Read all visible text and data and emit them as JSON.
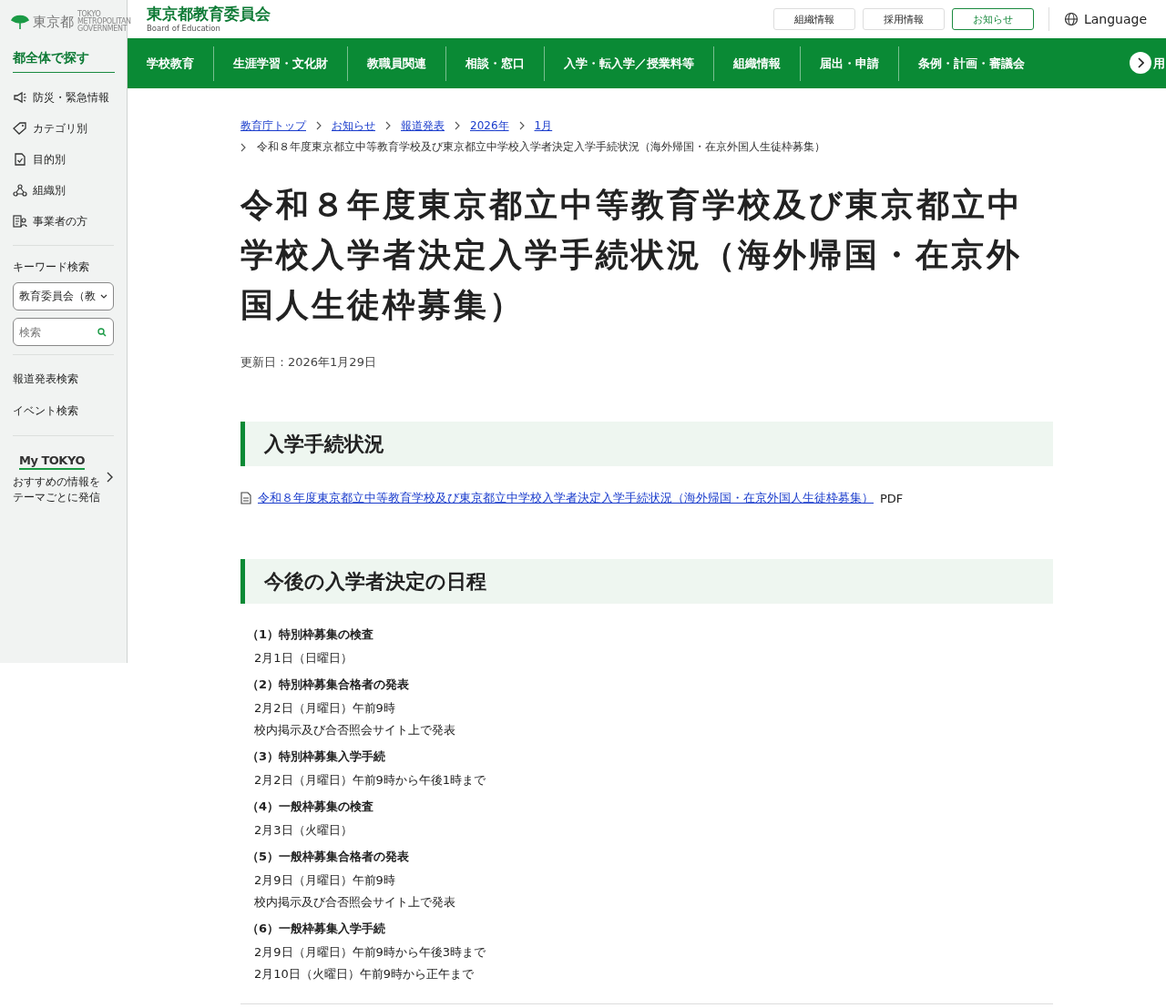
{
  "sidebar": {
    "logo": "東京都",
    "logo_sub": [
      "TOKYO",
      "METROPOLITAN",
      "GOVERNMENT"
    ],
    "heading": "都全体で探す",
    "items": [
      {
        "label": "防災・緊急情報"
      },
      {
        "label": "カテゴリ別"
      },
      {
        "label": "目的別"
      },
      {
        "label": "組織別"
      },
      {
        "label": "事業者の方"
      }
    ],
    "keyword_label": "キーワード検索",
    "scope_select": "教育委員会（教",
    "search": {
      "placeholder": "検索"
    },
    "links": [
      "報道発表検索",
      "イベント検索"
    ],
    "mytokyo": {
      "logo": "My TOKYO",
      "text": [
        "おすすめの情報を",
        "テーマごとに発信"
      ]
    }
  },
  "header": {
    "title": "東京都教育委員会",
    "subtitle": "Board of Education",
    "buttons": [
      {
        "label": "組織情報",
        "selected": false
      },
      {
        "label": "採用情報",
        "selected": false
      },
      {
        "label": "お知らせ",
        "selected": true
      }
    ],
    "language": "Language"
  },
  "nav": {
    "items": [
      "学校教育",
      "生涯学習・文化財",
      "教職員関連",
      "相談・窓口",
      "入学・転入学／授業料等",
      "組織情報",
      "届出・申請",
      "条例・計画・審議会"
    ],
    "cut_item": "用"
  },
  "breadcrumb": {
    "links": [
      "教育庁トップ",
      "お知らせ",
      "報道発表",
      "2026年",
      "1月"
    ],
    "current": "令和８年度東京都立中等教育学校及び東京都立中学校入学者決定入学手続状況（海外帰国・在京外国人生徒枠募集）"
  },
  "page_title": "令和８年度東京都立中等教育学校及び東京都立中学校入学者決定入学手続状況（海外帰国・在京外国人生徒枠募集）",
  "updated": "更新日：2026年1月29日",
  "sections": [
    {
      "heading": "入学手続状況",
      "file_link": {
        "label": "令和８年度東京都立中等教育学校及び東京都立中学校入学者決定入学手続状況（海外帰国・在京外国人生徒枠募集）",
        "type": "PDF"
      }
    },
    {
      "heading": "今後の入学者決定の日程",
      "schedule": [
        {
          "title": "（1）特別枠募集の検査",
          "lines": [
            "2月1日（日曜日）"
          ]
        },
        {
          "title": "（2）特別枠募集合格者の発表",
          "lines": [
            "2月2日（月曜日）午前9時",
            "校内掲示及び合否照会サイト上で発表"
          ]
        },
        {
          "title": "（3）特別枠募集入学手続",
          "lines": [
            "2月2日（月曜日）午前9時から午後1時まで"
          ]
        },
        {
          "title": "（4）一般枠募集の検査",
          "lines": [
            "2月3日（火曜日）"
          ]
        },
        {
          "title": "（5）一般枠募集合格者の発表",
          "lines": [
            "2月9日（月曜日）午前9時",
            "校内掲示及び合否照会サイト上で発表"
          ]
        },
        {
          "title": "（6）一般枠募集入学手続",
          "lines": [
            "2月9日（月曜日）午前9時から午後3時まで",
            "2月10日（火曜日）午前9時から正午まで"
          ]
        }
      ]
    }
  ]
}
